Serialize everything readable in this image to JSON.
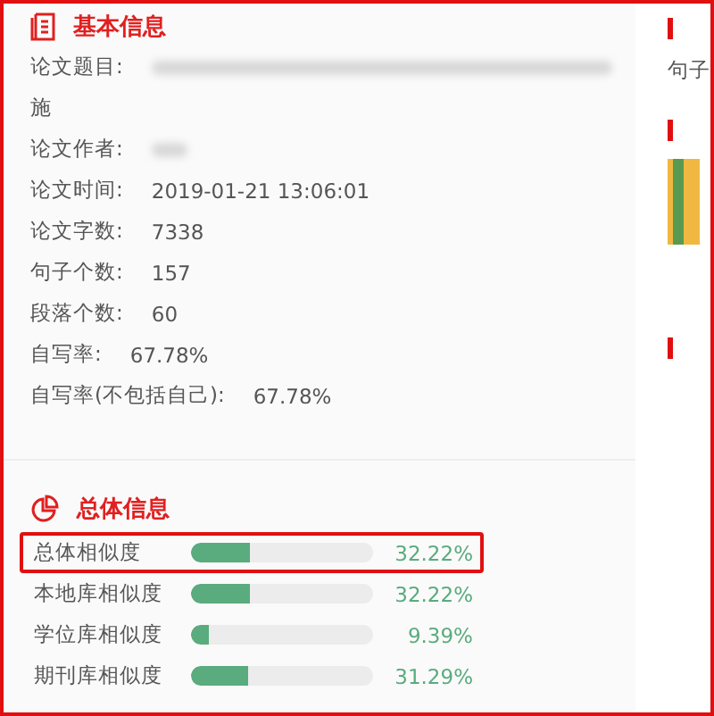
{
  "basic_info": {
    "title": "基本信息",
    "fields": [
      {
        "label": "论文题目:",
        "kind": "blurred_long",
        "continuation": "施"
      },
      {
        "label": "论文作者:",
        "kind": "blurred_short"
      },
      {
        "label": "论文时间:",
        "kind": "text",
        "value": "2019-01-21 13:06:01"
      },
      {
        "label": "论文字数:",
        "kind": "text",
        "value": "7338"
      },
      {
        "label": "句子个数:",
        "kind": "text",
        "value": "157"
      },
      {
        "label": "段落个数:",
        "kind": "text",
        "value": "60"
      },
      {
        "label": "自写率:",
        "kind": "text",
        "value": "67.78%"
      },
      {
        "label": "自写率(不包括自己):",
        "kind": "text",
        "value": "67.78%"
      }
    ]
  },
  "overall_info": {
    "title": "总体信息",
    "metrics": [
      {
        "label": "总体相似度",
        "level": 0.3222,
        "reading": "32.22%",
        "selected": true
      },
      {
        "label": "本地库相似度",
        "level": 0.3222,
        "reading": "32.22%",
        "selected": false
      },
      {
        "label": "学位库相似度",
        "level": 0.0939,
        "reading": "9.39%",
        "selected": false
      },
      {
        "label": "期刊库相似度",
        "level": 0.3129,
        "reading": "31.29%",
        "selected": false
      }
    ]
  },
  "side_panel": {
    "text": "句子"
  }
}
